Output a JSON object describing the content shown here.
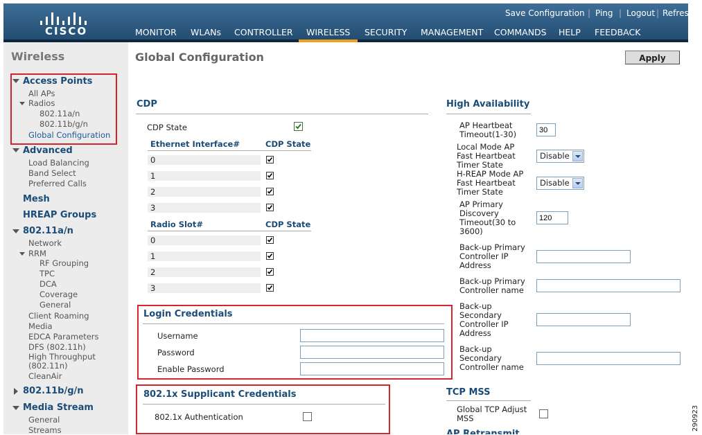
{
  "header": {
    "logo_text": "CISCO",
    "links": [
      "Save Configuration",
      "Ping",
      "Logout",
      "Refresh"
    ],
    "nav": [
      "MONITOR",
      "WLANs",
      "CONTROLLER",
      "WIRELESS",
      "SECURITY",
      "MANAGEMENT",
      "COMMANDS",
      "HELP",
      "FEEDBACK"
    ],
    "active_nav": "WIRELESS",
    "colors": {
      "bar": "#2c5a82",
      "active": "#f0a020",
      "highlight_box": "#d6232c"
    }
  },
  "sidebar": {
    "title": "Wireless",
    "access_points": {
      "label": "Access Points",
      "all_aps": "All APs",
      "radios": "Radios",
      "radio_a": "802.11a/n",
      "radio_bg": "802.11b/g/n",
      "global_config": "Global Configuration"
    },
    "advanced": {
      "label": "Advanced",
      "items": [
        "Load Balancing",
        "Band Select",
        "Preferred Calls"
      ]
    },
    "mesh": "Mesh",
    "hreap_groups": "HREAP Groups",
    "a_n": {
      "label": "802.11a/n",
      "network": "Network",
      "rrm": "RRM",
      "rrm_items": [
        "RF Grouping",
        "TPC",
        "DCA",
        "Coverage",
        "General"
      ],
      "items": [
        "Client Roaming",
        "Media",
        "EDCA Parameters",
        "DFS (802.11h)",
        "High Throughput",
        "(802.11n)",
        "CleanAir"
      ]
    },
    "bg_n": "802.11b/g/n",
    "media_stream": {
      "label": "Media Stream",
      "items": [
        "General",
        "Streams"
      ]
    }
  },
  "main": {
    "title": "Global Configuration",
    "apply_label": "Apply",
    "cdp": {
      "heading": "CDP",
      "state_label": "CDP State",
      "state_checked": true,
      "eth_header": "Ethernet Interface#",
      "cdp_state_header": "CDP State",
      "eth_rows": [
        "0",
        "1",
        "2",
        "3"
      ],
      "radio_header": "Radio Slot#",
      "radio_rows": [
        "0",
        "1",
        "2",
        "3"
      ]
    },
    "login": {
      "heading": "Login Credentials",
      "username": "Username",
      "password": "Password",
      "enable_password": "Enable Password"
    },
    "supplicant": {
      "heading": "802.1x Supplicant Credentials",
      "auth_label": "802.1x Authentication",
      "auth_checked": false
    },
    "ha": {
      "heading": "High Availability",
      "heartbeat_label": [
        "AP Heartbeat",
        "Timeout(1-30)"
      ],
      "heartbeat_value": "30",
      "local_fast_label": [
        "Local Mode AP",
        "Fast Heartbeat",
        "Timer State"
      ],
      "local_fast_value": "Disable",
      "hreap_fast_label": [
        "H-REAP Mode AP",
        "Fast Heartbeat",
        "Timer State"
      ],
      "hreap_fast_value": "Disable",
      "primary_disc_label": [
        "AP Primary",
        "Discovery",
        "Timeout(30 to",
        "3600)"
      ],
      "primary_disc_value": "120",
      "backup_primary_ip_label": [
        "Back-up Primary",
        "Controller IP",
        "Address"
      ],
      "backup_primary_name_label": [
        "Back-up Primary",
        "Controller name"
      ],
      "backup_secondary_ip_label": [
        "Back-up",
        "Secondary",
        "Controller IP",
        "Address"
      ],
      "backup_secondary_name_label": [
        "Back-up",
        "Secondary",
        "Controller name"
      ]
    },
    "tcp_mss": {
      "heading": "TCP MSS",
      "label": [
        "Global TCP Adjust",
        "MSS"
      ]
    },
    "partial_heading": "AP Retransmit"
  },
  "figure_id": "290923"
}
